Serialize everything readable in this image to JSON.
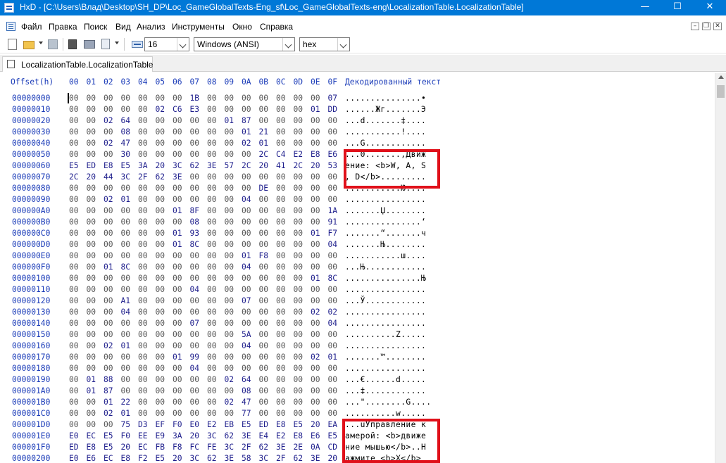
{
  "window": {
    "title": "HxD - [C:\\Users\\Влад\\Desktop\\SH_DP\\Loc_GameGlobalTexts-Eng_sf\\Loc_GameGlobalTexts-eng\\LocalizationTable.LocalizationTable]",
    "minimize": "—",
    "maximize": "☐",
    "close": "✕"
  },
  "menu": [
    "Файл",
    "Правка",
    "Поиск",
    "Вид",
    "Анализ",
    "Инструменты",
    "Окно",
    "Справка"
  ],
  "toolbar": {
    "bytes_per_row": "16",
    "charset": "Windows (ANSI)",
    "offset_base": "hex"
  },
  "tab": {
    "label": "LocalizationTable.LocalizationTable"
  },
  "hex_header": {
    "offset_label": "Offset(h)",
    "columns": [
      "00",
      "01",
      "02",
      "03",
      "04",
      "05",
      "06",
      "07",
      "08",
      "09",
      "0A",
      "0B",
      "0C",
      "0D",
      "0E",
      "0F"
    ],
    "decoded_label": "Декодированный текст"
  },
  "rows": [
    {
      "offset": "00000000",
      "bytes": [
        "00",
        "00",
        "00",
        "00",
        "00",
        "00",
        "00",
        "1B",
        "00",
        "00",
        "00",
        "00",
        "00",
        "00",
        "00",
        "07"
      ],
      "text": "...............•"
    },
    {
      "offset": "00000010",
      "bytes": [
        "00",
        "00",
        "00",
        "00",
        "00",
        "02",
        "C6",
        "E3",
        "00",
        "00",
        "00",
        "00",
        "00",
        "00",
        "01",
        "DD"
      ],
      "text": "......Жг.......Э"
    },
    {
      "offset": "00000020",
      "bytes": [
        "00",
        "00",
        "02",
        "64",
        "00",
        "00",
        "00",
        "00",
        "00",
        "01",
        "87",
        "00",
        "00",
        "00",
        "00",
        "00"
      ],
      "text": "...d.......‡...."
    },
    {
      "offset": "00000030",
      "bytes": [
        "00",
        "00",
        "00",
        "08",
        "00",
        "00",
        "00",
        "00",
        "00",
        "00",
        "01",
        "21",
        "00",
        "00",
        "00",
        "00"
      ],
      "text": "...........!...."
    },
    {
      "offset": "00000040",
      "bytes": [
        "00",
        "00",
        "02",
        "47",
        "00",
        "00",
        "00",
        "00",
        "00",
        "00",
        "02",
        "01",
        "00",
        "00",
        "00",
        "00"
      ],
      "text": "...G............"
    },
    {
      "offset": "00000050",
      "bytes": [
        "00",
        "00",
        "00",
        "30",
        "00",
        "00",
        "00",
        "00",
        "00",
        "00",
        "00",
        "2C",
        "C4",
        "E2",
        "E8",
        "E6"
      ],
      "text": "...0.......,Движ"
    },
    {
      "offset": "00000060",
      "bytes": [
        "E5",
        "ED",
        "E8",
        "E5",
        "3A",
        "20",
        "3C",
        "62",
        "3E",
        "57",
        "2C",
        "20",
        "41",
        "2C",
        "20",
        "53"
      ],
      "text": "ение: <b>W, A, S"
    },
    {
      "offset": "00000070",
      "bytes": [
        "2C",
        "20",
        "44",
        "3C",
        "2F",
        "62",
        "3E",
        "00",
        "00",
        "00",
        "00",
        "00",
        "00",
        "00",
        "00",
        "00"
      ],
      "text": ", D</b>........."
    },
    {
      "offset": "00000080",
      "bytes": [
        "00",
        "00",
        "00",
        "00",
        "00",
        "00",
        "00",
        "00",
        "00",
        "00",
        "00",
        "DE",
        "00",
        "00",
        "00",
        "00"
      ],
      "text": "...........Ю...."
    },
    {
      "offset": "00000090",
      "bytes": [
        "00",
        "00",
        "02",
        "01",
        "00",
        "00",
        "00",
        "00",
        "00",
        "00",
        "04",
        "00",
        "00",
        "00",
        "00",
        "00"
      ],
      "text": "................"
    },
    {
      "offset": "000000A0",
      "bytes": [
        "00",
        "00",
        "00",
        "00",
        "00",
        "00",
        "01",
        "8F",
        "00",
        "00",
        "00",
        "00",
        "00",
        "00",
        "00",
        "1A"
      ],
      "text": ".......Џ........"
    },
    {
      "offset": "000000B0",
      "bytes": [
        "00",
        "00",
        "00",
        "00",
        "00",
        "00",
        "00",
        "08",
        "00",
        "00",
        "00",
        "00",
        "00",
        "00",
        "00",
        "91"
      ],
      "text": "...............‘"
    },
    {
      "offset": "000000C0",
      "bytes": [
        "00",
        "00",
        "00",
        "00",
        "00",
        "00",
        "01",
        "93",
        "00",
        "00",
        "00",
        "00",
        "00",
        "00",
        "01",
        "F7"
      ],
      "text": ".......“.......ч"
    },
    {
      "offset": "000000D0",
      "bytes": [
        "00",
        "00",
        "00",
        "00",
        "00",
        "00",
        "01",
        "8C",
        "00",
        "00",
        "00",
        "00",
        "00",
        "00",
        "00",
        "04"
      ],
      "text": ".......Њ........"
    },
    {
      "offset": "000000E0",
      "bytes": [
        "00",
        "00",
        "00",
        "00",
        "00",
        "00",
        "00",
        "00",
        "00",
        "00",
        "01",
        "F8",
        "00",
        "00",
        "00",
        "00"
      ],
      "text": "...........ш...."
    },
    {
      "offset": "000000F0",
      "bytes": [
        "00",
        "00",
        "01",
        "8C",
        "00",
        "00",
        "00",
        "00",
        "00",
        "00",
        "04",
        "00",
        "00",
        "00",
        "00",
        "00"
      ],
      "text": "...Њ............"
    },
    {
      "offset": "00000100",
      "bytes": [
        "00",
        "00",
        "00",
        "00",
        "00",
        "00",
        "00",
        "00",
        "00",
        "00",
        "00",
        "00",
        "00",
        "00",
        "01",
        "8C"
      ],
      "text": "...............Њ"
    },
    {
      "offset": "00000110",
      "bytes": [
        "00",
        "00",
        "00",
        "00",
        "00",
        "00",
        "00",
        "04",
        "00",
        "00",
        "00",
        "00",
        "00",
        "00",
        "00",
        "00"
      ],
      "text": "................"
    },
    {
      "offset": "00000120",
      "bytes": [
        "00",
        "00",
        "00",
        "A1",
        "00",
        "00",
        "00",
        "00",
        "00",
        "00",
        "07",
        "00",
        "00",
        "00",
        "00",
        "00"
      ],
      "text": "...Ў............"
    },
    {
      "offset": "00000130",
      "bytes": [
        "00",
        "00",
        "00",
        "04",
        "00",
        "00",
        "00",
        "00",
        "00",
        "00",
        "00",
        "00",
        "00",
        "00",
        "02",
        "02"
      ],
      "text": "................"
    },
    {
      "offset": "00000140",
      "bytes": [
        "00",
        "00",
        "00",
        "00",
        "00",
        "00",
        "00",
        "07",
        "00",
        "00",
        "00",
        "00",
        "00",
        "00",
        "00",
        "04"
      ],
      "text": "................"
    },
    {
      "offset": "00000150",
      "bytes": [
        "00",
        "00",
        "00",
        "00",
        "00",
        "00",
        "00",
        "00",
        "00",
        "00",
        "5A",
        "00",
        "00",
        "00",
        "00",
        "00"
      ],
      "text": "..........Z....."
    },
    {
      "offset": "00000160",
      "bytes": [
        "00",
        "00",
        "02",
        "01",
        "00",
        "00",
        "00",
        "00",
        "00",
        "00",
        "04",
        "00",
        "00",
        "00",
        "00",
        "00"
      ],
      "text": "................"
    },
    {
      "offset": "00000170",
      "bytes": [
        "00",
        "00",
        "00",
        "00",
        "00",
        "00",
        "01",
        "99",
        "00",
        "00",
        "00",
        "00",
        "00",
        "00",
        "02",
        "01"
      ],
      "text": ".......™........"
    },
    {
      "offset": "00000180",
      "bytes": [
        "00",
        "00",
        "00",
        "00",
        "00",
        "00",
        "00",
        "04",
        "00",
        "00",
        "00",
        "00",
        "00",
        "00",
        "00",
        "00"
      ],
      "text": "................"
    },
    {
      "offset": "00000190",
      "bytes": [
        "00",
        "01",
        "88",
        "00",
        "00",
        "00",
        "00",
        "00",
        "00",
        "02",
        "64",
        "00",
        "00",
        "00",
        "00",
        "00"
      ],
      "text": "...€......d....."
    },
    {
      "offset": "000001A0",
      "bytes": [
        "00",
        "01",
        "87",
        "00",
        "00",
        "00",
        "00",
        "00",
        "00",
        "00",
        "08",
        "00",
        "00",
        "00",
        "00",
        "00"
      ],
      "text": "...‡............"
    },
    {
      "offset": "000001B0",
      "bytes": [
        "00",
        "00",
        "01",
        "22",
        "00",
        "00",
        "00",
        "00",
        "00",
        "02",
        "47",
        "00",
        "00",
        "00",
        "00",
        "00"
      ],
      "text": "...\"........G...."
    },
    {
      "offset": "000001C0",
      "bytes": [
        "00",
        "00",
        "02",
        "01",
        "00",
        "00",
        "00",
        "00",
        "00",
        "00",
        "77",
        "00",
        "00",
        "00",
        "00",
        "00"
      ],
      "text": "..........w....."
    },
    {
      "offset": "000001D0",
      "bytes": [
        "00",
        "00",
        "00",
        "75",
        "D3",
        "EF",
        "F0",
        "E0",
        "E2",
        "EB",
        "E5",
        "ED",
        "E8",
        "E5",
        "20",
        "EA"
      ],
      "text": "...uУправление к"
    },
    {
      "offset": "000001E0",
      "bytes": [
        "E0",
        "EC",
        "E5",
        "F0",
        "EE",
        "E9",
        "3A",
        "20",
        "3C",
        "62",
        "3E",
        "E4",
        "E2",
        "E8",
        "E6",
        "E5"
      ],
      "text": "амерой: <b>движе"
    },
    {
      "offset": "000001F0",
      "bytes": [
        "ED",
        "E8",
        "E5",
        "20",
        "EC",
        "FB",
        "F8",
        "FC",
        "FE",
        "3C",
        "2F",
        "62",
        "3E",
        "2E",
        "0A",
        "CD"
      ],
      "text": "ние мышью</b>..Н"
    },
    {
      "offset": "00000200",
      "bytes": [
        "E0",
        "E6",
        "EC",
        "E8",
        "F2",
        "E5",
        "20",
        "3C",
        "62",
        "3E",
        "58",
        "3C",
        "2F",
        "62",
        "3E",
        "20"
      ],
      "text": "ажмите <b>X</b> "
    }
  ]
}
